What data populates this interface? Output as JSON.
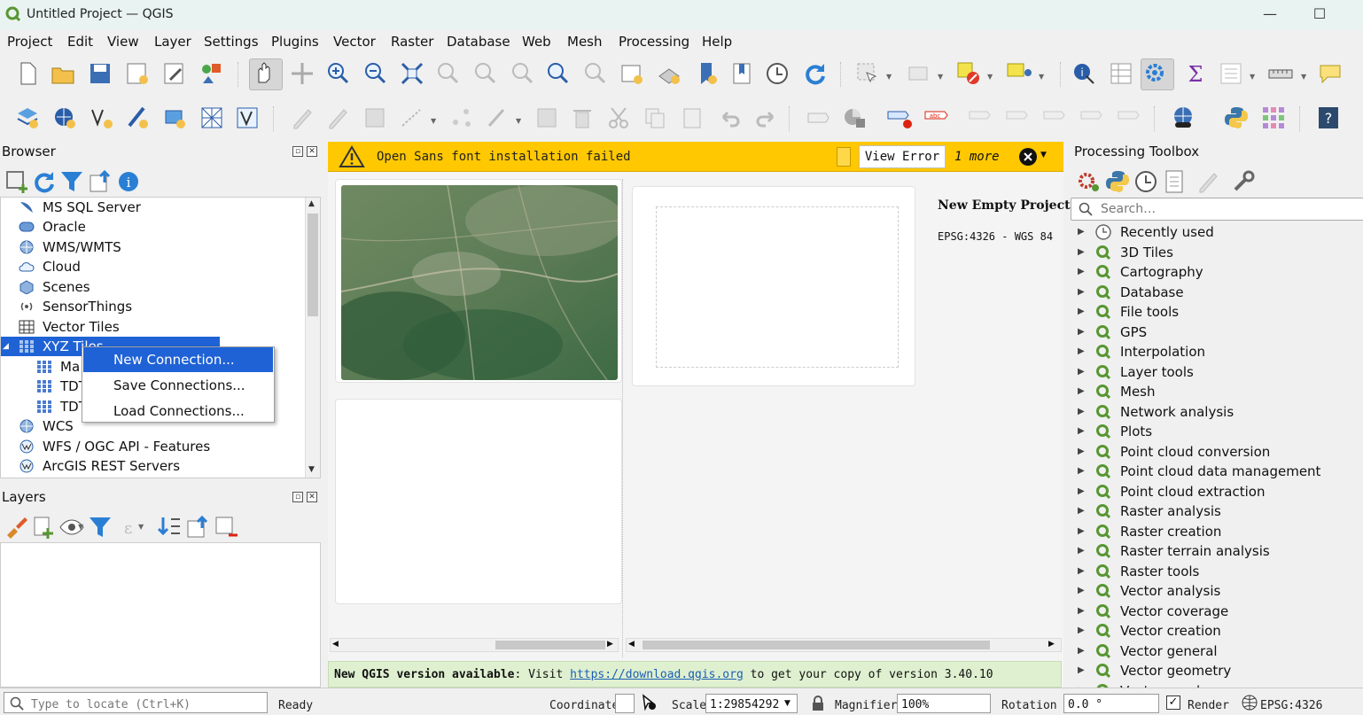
{
  "window": {
    "title": "Untitled Project — QGIS",
    "minimize": "—",
    "maximize": "☐"
  },
  "menu": [
    "Project",
    "Edit",
    "View",
    "Layer",
    "Settings",
    "Plugins",
    "Vector",
    "Raster",
    "Database",
    "Web",
    "Mesh",
    "Processing",
    "Help"
  ],
  "browser": {
    "title": "Browser",
    "items": [
      {
        "label": "MS SQL Server",
        "icon": "mssql-icon"
      },
      {
        "label": "Oracle",
        "icon": "oracle-icon"
      },
      {
        "label": "WMS/WMTS",
        "icon": "wms-icon"
      },
      {
        "label": "Cloud",
        "icon": "cloud-icon"
      },
      {
        "label": "Scenes",
        "icon": "scenes-icon"
      },
      {
        "label": "SensorThings",
        "icon": "sensorthings-icon"
      },
      {
        "label": "Vector Tiles",
        "icon": "vector-tiles-icon"
      },
      {
        "label": "XYZ Tiles",
        "icon": "xyz-tiles-icon"
      },
      {
        "label": "Ma",
        "icon": "xyz-layer-icon"
      },
      {
        "label": "TDT",
        "icon": "xyz-layer-icon"
      },
      {
        "label": "TDT",
        "icon": "xyz-layer-icon"
      },
      {
        "label": "WCS",
        "icon": "wcs-icon"
      },
      {
        "label": "WFS / OGC API - Features",
        "icon": "wfs-icon"
      },
      {
        "label": "ArcGIS REST Servers",
        "icon": "arcgis-icon"
      }
    ]
  },
  "context_menu": {
    "items": [
      "New Connection...",
      "Save Connections...",
      "Load Connections..."
    ],
    "highlighted": 0
  },
  "layers": {
    "title": "Layers"
  },
  "message_bar": {
    "text": "Open Sans font installation failed",
    "button": "View Error",
    "more": "1 more"
  },
  "welcome": {
    "project_title": "New Empty Project",
    "crs": "EPSG:4326 - WGS 84"
  },
  "update_bar": {
    "prefix": "New QGIS version available",
    "mid": ": Visit ",
    "link": "https://download.qgis.org",
    "suffix": " to get your copy of version 3.40.10"
  },
  "toolbox": {
    "title": "Processing Toolbox",
    "search_placeholder": "Search…",
    "items": [
      "Recently used",
      "3D Tiles",
      "Cartography",
      "Database",
      "File tools",
      "GPS",
      "Interpolation",
      "Layer tools",
      "Mesh",
      "Network analysis",
      "Plots",
      "Point cloud conversion",
      "Point cloud data management",
      "Point cloud extraction",
      "Raster analysis",
      "Raster creation",
      "Raster terrain analysis",
      "Raster tools",
      "Vector analysis",
      "Vector coverage",
      "Vector creation",
      "Vector general",
      "Vector geometry",
      "Vector overlay"
    ]
  },
  "statusbar": {
    "locator_placeholder": "Type to locate (Ctrl+K)",
    "ready": "Ready",
    "coordinate_label": "Coordinate",
    "coordinate_value": "",
    "scale_label": "Scale",
    "scale_value": "1:29854292",
    "magnifier_label": "Magnifier",
    "magnifier_value": "100%",
    "rotation_label": "Rotation",
    "rotation_value": "0.0 °",
    "render_label": "Render",
    "crs": "EPSG:4326"
  },
  "colors": {
    "accent": "#1f62d6",
    "qgis_green": "#589632",
    "warning": "#ffc800"
  }
}
